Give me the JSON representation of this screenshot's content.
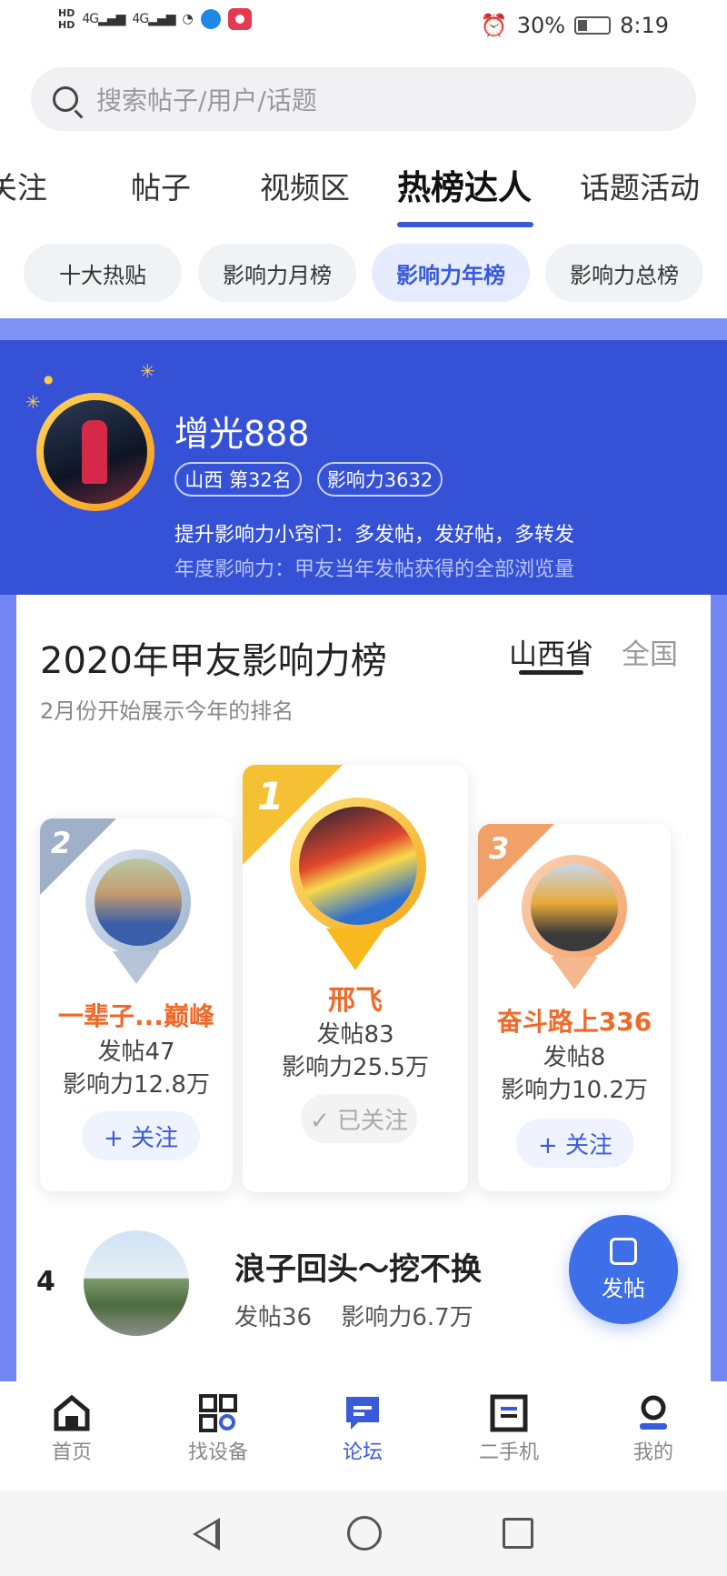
{
  "status_bar": {
    "hd1": "HD",
    "hd2": "HD",
    "net1": "4G",
    "net2": "4G",
    "battery": "30%",
    "time": "8:19"
  },
  "search": {
    "placeholder": "搜索帖子/用户/话题"
  },
  "tabs": [
    "关注",
    "帖子",
    "视频区",
    "热榜达人",
    "话题活动"
  ],
  "active_tab": "热榜达人",
  "chips": [
    "十大热贴",
    "影响力月榜",
    "影响力年榜",
    "影响力总榜"
  ],
  "active_chip": "影响力年榜",
  "me": {
    "name": "增光888",
    "region_rank": "山西  第32名",
    "influence": "影响力3632",
    "tip": "提升影响力小窍门：多发帖，发好帖，多转发",
    "definition": "年度影响力：甲友当年发帖获得的全部浏览量"
  },
  "board": {
    "title": "2020年甲友影响力榜",
    "subtitle": "2月份开始展示今年的排名",
    "region_active": "山西省",
    "region_other": "全国"
  },
  "podium": [
    {
      "rank": "2",
      "name": "一辈子...巅峰",
      "posts": "发帖47",
      "influence": "影响力12.8万",
      "button": "+ 关注"
    },
    {
      "rank": "1",
      "name": "邢飞",
      "posts": "发帖83",
      "influence": "影响力25.5万",
      "button": "✓ 已关注"
    },
    {
      "rank": "3",
      "name": "奋斗路上336",
      "posts": "发帖8",
      "influence": "影响力10.2万",
      "button": "+ 关注"
    }
  ],
  "list": [
    {
      "rank": "4",
      "name": "浪子回头～挖不换",
      "posts": "发帖36",
      "influence": "影响力6.7万"
    }
  ],
  "fab": {
    "label": "发帖"
  },
  "bottom_nav": [
    "首页",
    "找设备",
    "论坛",
    "二手机",
    "我的"
  ],
  "active_nav": "论坛",
  "colors": {
    "accent": "#3a5bd9",
    "band": "#3551d6",
    "gold": "#f5b51c",
    "silver": "#9fb3cc",
    "bronze": "#f2a06a"
  }
}
